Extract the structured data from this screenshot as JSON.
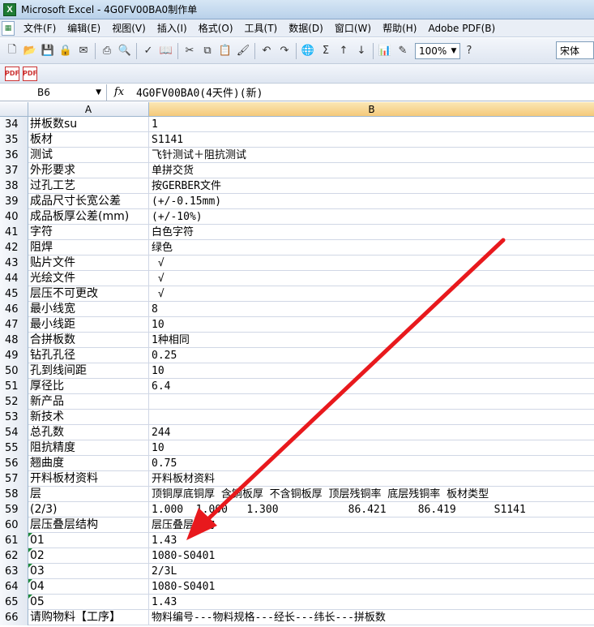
{
  "window": {
    "title": "Microsoft Excel - 4G0FV00BA0制作单",
    "icon": "excel-icon"
  },
  "menu": [
    "文件(F)",
    "编辑(E)",
    "视图(V)",
    "插入(I)",
    "格式(O)",
    "工具(T)",
    "数据(D)",
    "窗口(W)",
    "帮助(H)",
    "Adobe PDF(B)"
  ],
  "toolbar": {
    "zoom": "100%",
    "font": "宋体"
  },
  "formula": {
    "namebox": "B6",
    "fx": "fx",
    "content": "4G0FV00BA0(4天件)(新)"
  },
  "columns": {
    "a": "A",
    "b": "B"
  },
  "rows": [
    {
      "n": "34",
      "a": "拼板数su",
      "b": "1"
    },
    {
      "n": "35",
      "a": "板材",
      "b": "S1141"
    },
    {
      "n": "36",
      "a": "测试",
      "b": "飞针测试＋阻抗测试"
    },
    {
      "n": "37",
      "a": "外形要求",
      "b": "单拼交货"
    },
    {
      "n": "38",
      "a": "过孔工艺",
      "b": "按GERBER文件"
    },
    {
      "n": "39",
      "a": "成品尺寸长宽公差",
      "b": "(+/-0.15mm)"
    },
    {
      "n": "40",
      "a": "成品板厚公差(mm)",
      "b": "(+/-10%)"
    },
    {
      "n": "41",
      "a": "字符",
      "b": "白色字符"
    },
    {
      "n": "42",
      "a": "阻焊",
      "b": "绿色"
    },
    {
      "n": "43",
      "a": "贴片文件",
      "b": " √"
    },
    {
      "n": "44",
      "a": "光绘文件",
      "b": " √"
    },
    {
      "n": "45",
      "a": "层压不可更改",
      "b": " √"
    },
    {
      "n": "46",
      "a": "最小线宽",
      "b": "8"
    },
    {
      "n": "47",
      "a": "最小线距",
      "b": "10"
    },
    {
      "n": "48",
      "a": "合拼板数",
      "b": "1种相同"
    },
    {
      "n": "49",
      "a": "钻孔孔径",
      "b": "0.25"
    },
    {
      "n": "50",
      "a": "孔到线间距",
      "b": "10"
    },
    {
      "n": "51",
      "a": "厚径比",
      "b": "6.4"
    },
    {
      "n": "52",
      "a": "新产品",
      "b": ""
    },
    {
      "n": "53",
      "a": "新技术",
      "b": ""
    },
    {
      "n": "54",
      "a": "总孔数",
      "b": "244"
    },
    {
      "n": "55",
      "a": "阻抗精度",
      "b": "10"
    },
    {
      "n": "56",
      "a": "翘曲度",
      "b": "0.75"
    },
    {
      "n": "57",
      "a": "开料板材资料",
      "b": "开料板材资料"
    },
    {
      "n": "58",
      "a": "层",
      "b": "顶铜厚底铜厚 含铜板厚 不含铜板厚 顶层残铜率 底层残铜率 板材类型"
    },
    {
      "n": "59",
      "a": "(2/3)",
      "b": "1.000  1.000   1.300           86.421     86.419      S1141"
    },
    {
      "n": "60",
      "a": "层压叠层结构",
      "b": "层压叠层结构"
    },
    {
      "n": "61",
      "a": "01",
      "b": "1.43",
      "tri": true
    },
    {
      "n": "62",
      "a": "02",
      "b": "1080-S0401",
      "tri": true
    },
    {
      "n": "63",
      "a": "03",
      "b": "2/3L",
      "tri": true
    },
    {
      "n": "64",
      "a": "04",
      "b": "1080-S0401",
      "tri": true
    },
    {
      "n": "65",
      "a": "05",
      "b": "1.43",
      "tri": true
    },
    {
      "n": "66",
      "a": "请购物料【工序】",
      "b": "物料编号---物料规格---经长---纬长---拼板数"
    }
  ],
  "annotation": {
    "color": "#e8191d",
    "from_row": "46",
    "to_row": "61"
  }
}
